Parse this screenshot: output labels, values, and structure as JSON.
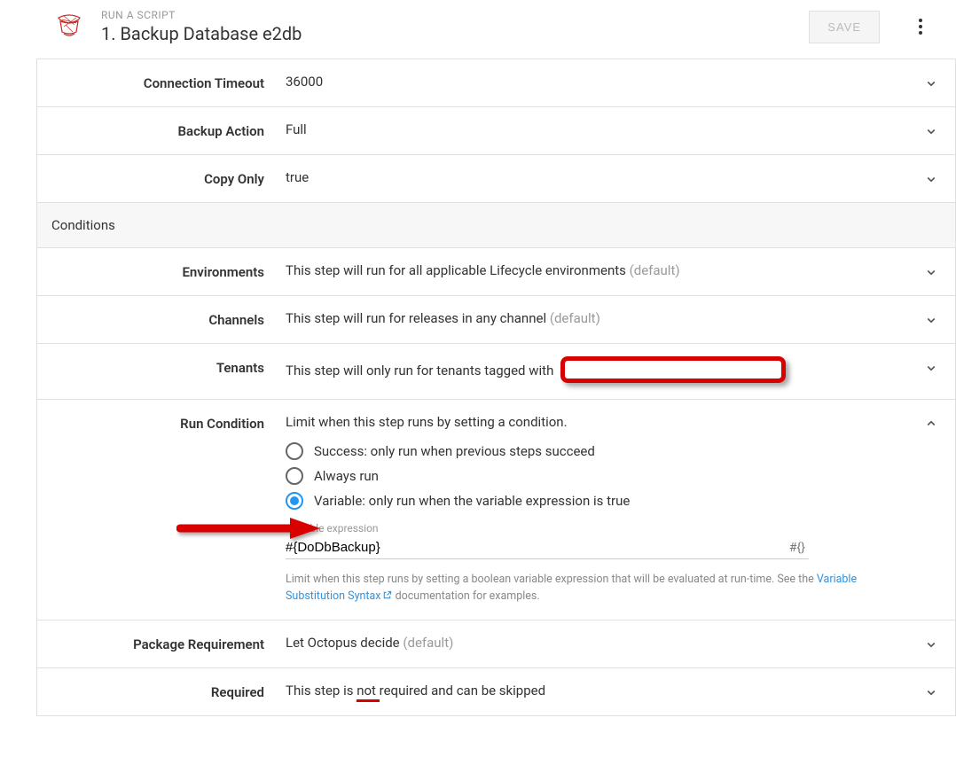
{
  "header": {
    "subtitle": "RUN A SCRIPT",
    "title": "1.  Backup Database e2db",
    "save_label": "SAVE"
  },
  "rows": {
    "connection_timeout": {
      "label": "Connection Timeout",
      "value": "36000"
    },
    "backup_action": {
      "label": "Backup Action",
      "value": "Full"
    },
    "copy_only": {
      "label": "Copy Only",
      "value": "true"
    },
    "environments": {
      "label": "Environments",
      "value": "This step will run for all applicable Lifecycle environments ",
      "default": "(default)"
    },
    "channels": {
      "label": "Channels",
      "value": "This step will run for releases in any channel ",
      "default": "(default)"
    },
    "tenants": {
      "label": "Tenants",
      "value": "This step will only run for tenants tagged with "
    },
    "run_condition": {
      "label": "Run Condition",
      "description": "Limit when this step runs by setting a condition.",
      "options": {
        "success": "Success: only run when previous steps succeed",
        "always": "Always run",
        "variable": "Variable: only run when the variable expression is true"
      },
      "var_label": "Variable expression",
      "var_value": "#{DoDbBackup}",
      "help_prefix": "Limit when this step runs by setting a boolean variable expression that will be evaluated at run-time. See the ",
      "help_link": "Variable Substitution Syntax",
      "help_suffix": " documentation for examples."
    },
    "package_requirement": {
      "label": "Package Requirement",
      "value": "Let Octopus decide ",
      "default": "(default)"
    },
    "required": {
      "label": "Required",
      "prefix": "This step is ",
      "emph": "not ",
      "suffix": "required and can be skipped"
    }
  },
  "sections": {
    "conditions": "Conditions"
  }
}
